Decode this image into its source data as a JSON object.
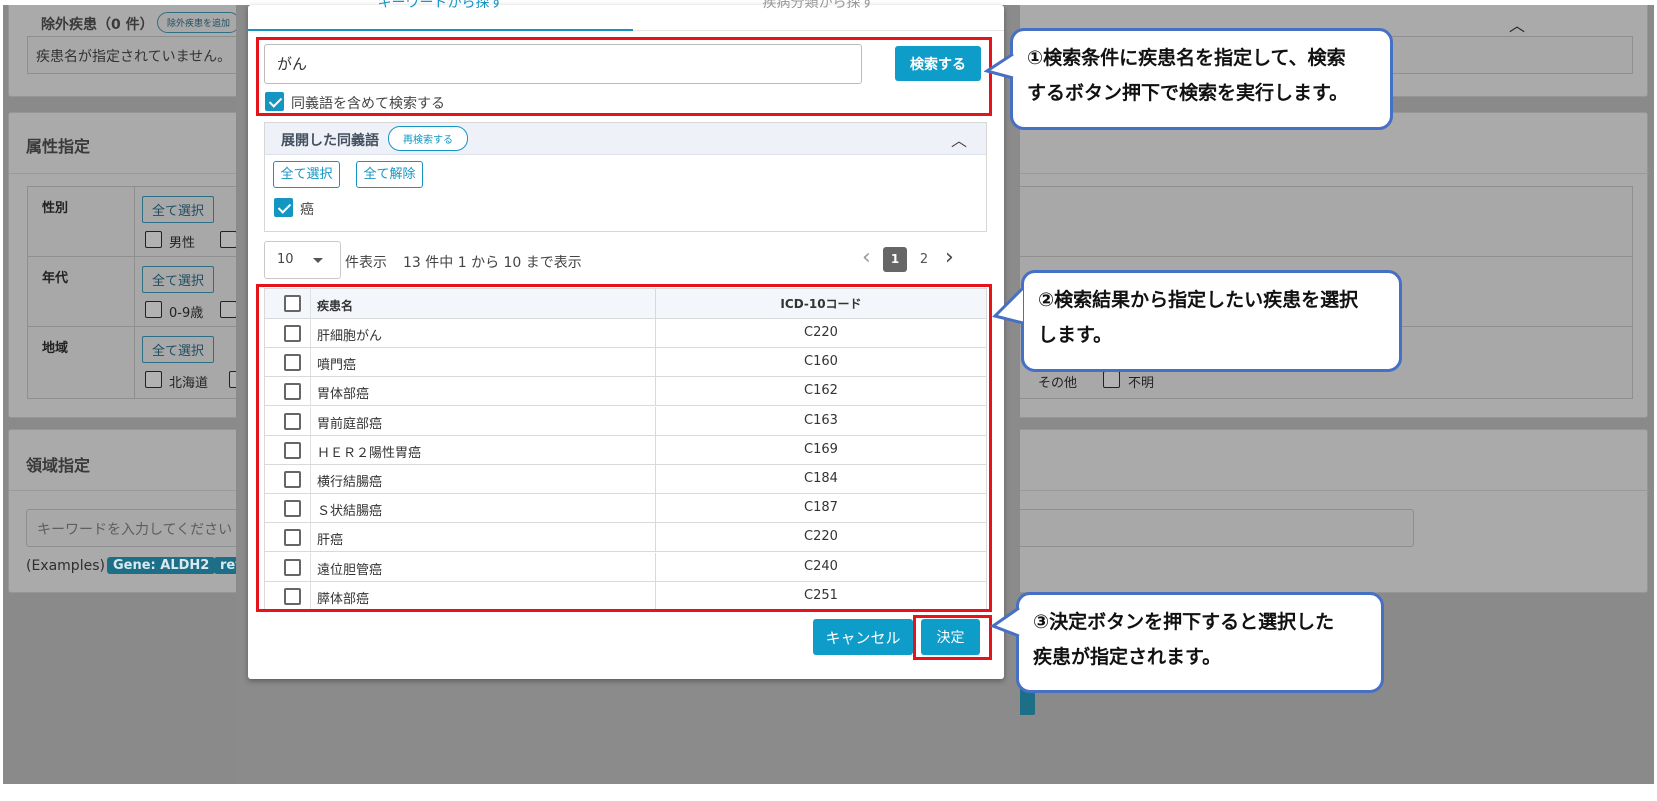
{
  "background": {
    "excluded": {
      "title": "除外疾患（0 件）",
      "add_button": "除外疾患を追加",
      "empty_text": "疾患名が指定されていません。"
    },
    "attributes": {
      "title": "属性指定",
      "sex_label": "性別",
      "sex_select_all": "全て選択",
      "sex_male": "男性",
      "age_label": "年代",
      "age_select_all": "全て選択",
      "age_0_9": "0-9歳",
      "region_label": "地域",
      "region_select_all": "全て選択",
      "region_hokkaido": "北海道",
      "region_other": "その他",
      "region_unknown": "不明"
    },
    "domain": {
      "title": "領域指定",
      "placeholder": "キーワードを入力してください",
      "examples_label": "(Examples)",
      "example_tag1": "Gene: ALDH2",
      "example_tag2": "ref"
    }
  },
  "dialog": {
    "tabs": [
      "キーワードから探す",
      "疾病分類から探す"
    ],
    "search": {
      "value": "がん",
      "button": "検索する",
      "synonym_label": "同義語を含めて検索する"
    },
    "synonyms": {
      "title": "展開した同義語",
      "research_button": "再検索する",
      "select_all": "全て選択",
      "deselect_all": "全て解除",
      "items": [
        "癌"
      ]
    },
    "pagination": {
      "per_page": "10",
      "per_page_suffix": "件表示",
      "summary": "13 件中 1 から 10 まで表示",
      "prev": "‹",
      "pages": [
        "1",
        "2"
      ],
      "next": "›",
      "current_page": 1
    },
    "table": {
      "headers": [
        "疾患名",
        "ICD-10コード"
      ],
      "rows": [
        {
          "name": "肝細胞がん",
          "code": "C220"
        },
        {
          "name": "噴門癌",
          "code": "C160"
        },
        {
          "name": "胃体部癌",
          "code": "C162"
        },
        {
          "name": "胃前庭部癌",
          "code": "C163"
        },
        {
          "name": "ＨＥＲ２陽性胃癌",
          "code": "C169"
        },
        {
          "name": "横行結腸癌",
          "code": "C184"
        },
        {
          "name": "Ｓ状結腸癌",
          "code": "C187"
        },
        {
          "name": "肝癌",
          "code": "C220"
        },
        {
          "name": "遠位胆管癌",
          "code": "C240"
        },
        {
          "name": "膵体部癌",
          "code": "C251"
        }
      ]
    },
    "cancel_button": "キャンセル",
    "confirm_button": "決定"
  },
  "callouts": {
    "c1": [
      "①検索条件に疾患名を指定して、検索",
      "するボタン押下で検索を実行します。"
    ],
    "c2": [
      "②検索結果から指定したい疾患を選択",
      "します。"
    ],
    "c3": [
      "③決定ボタンを押下すると選択した",
      "疾患が指定されます。"
    ]
  },
  "colors": {
    "accent": "#0e9cc9",
    "highlight": "#e4141a",
    "callout_border": "#4670c4"
  }
}
